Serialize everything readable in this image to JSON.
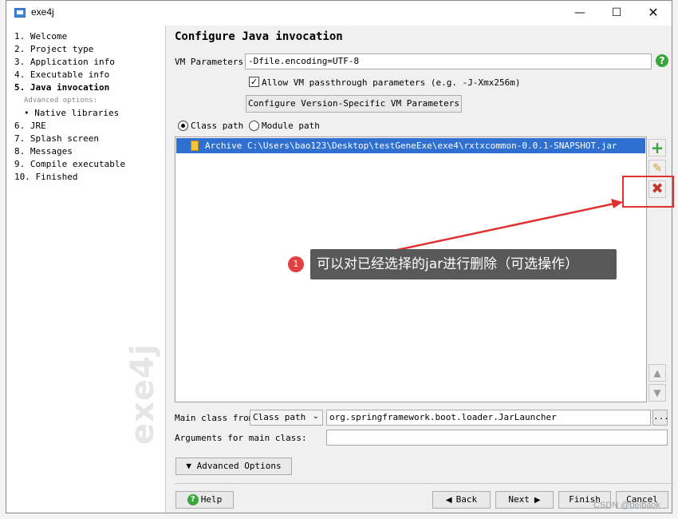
{
  "window": {
    "title": "exe4j",
    "controls": {
      "minimize": "—",
      "maximize": "☐",
      "close": "✕"
    }
  },
  "steps": [
    {
      "label": "1. Welcome"
    },
    {
      "label": "2. Project type"
    },
    {
      "label": "3. Application info"
    },
    {
      "label": "4. Executable info"
    },
    {
      "label": "5. Java invocation",
      "active": true
    },
    {
      "label": "Advanced options:"
    },
    {
      "label": "• Native libraries"
    },
    {
      "label": "6. JRE"
    },
    {
      "label": "7. Splash screen"
    },
    {
      "label": "8. Messages"
    },
    {
      "label": "9. Compile executable"
    },
    {
      "label": "10. Finished"
    }
  ],
  "sidebar_watermark": "exe4j",
  "main": {
    "title": "Configure Java invocation",
    "vm_params_label": "VM Parameters:",
    "vm_params_value": "-Dfile.encoding=UTF-8",
    "passthrough_label": "Allow VM passthrough parameters (e.g. -J-Xmx256m)",
    "passthrough_checked": true,
    "version_specific_button": "Configure Version-Specific VM Parameters",
    "class_path_radio": "Class path",
    "module_path_radio": "Module path",
    "selected_radio": "Class path",
    "classpath_entries": [
      {
        "text": "Archive C:\\Users\\bao123\\Desktop\\testGeneExe\\exe4\\rxtxcommon-0.0.1-SNAPSHOT.jar",
        "selected": true
      }
    ],
    "main_class_label": "Main class from",
    "main_class_source": "Class path",
    "main_class_value": "org.springframework.boot.loader.JarLauncher",
    "browse_button": "...",
    "arguments_label": "Arguments for main class:",
    "arguments_value": "",
    "advanced_options_button": "▼ Advanced Options"
  },
  "annotation": {
    "badge": "1",
    "text": "可以对已经选择的jar进行删除（可选操作）"
  },
  "buttons": {
    "help": "Help",
    "back": "Back",
    "next": "Next",
    "finish": "Finish",
    "cancel": "Cancel"
  },
  "footer_watermark": "CSDN @beibaok",
  "colors": {
    "selection": "#2f6fd0",
    "add_icon": "#3aa53a",
    "delete_icon": "#c0392b",
    "callout": "#e03030",
    "tooltip_bg": "#595959"
  }
}
